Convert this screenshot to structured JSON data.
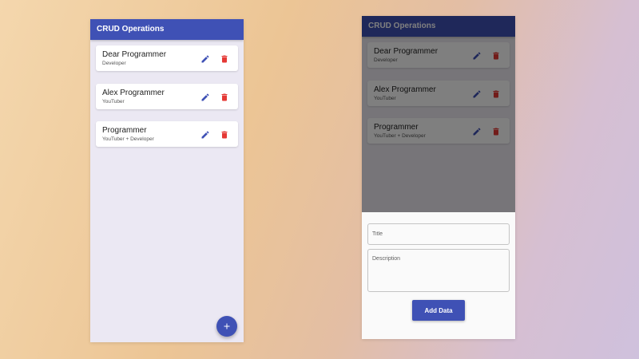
{
  "app": {
    "title": "CRUD Operations",
    "primary_color": "#3f51b5",
    "delete_color": "#e53935"
  },
  "items": [
    {
      "title": "Dear Programmer",
      "description": "Developer"
    },
    {
      "title": "Alex Programmer",
      "description": "YouTuber"
    },
    {
      "title": "Programmer",
      "description": "YouTuber + Developer"
    }
  ],
  "icons": {
    "edit": "edit-pencil-icon",
    "delete": "trash-icon",
    "add": "plus-icon"
  },
  "form": {
    "title_placeholder": "Title",
    "title_value": "",
    "description_placeholder": "Description",
    "description_value": "",
    "submit_label": "Add Data"
  }
}
